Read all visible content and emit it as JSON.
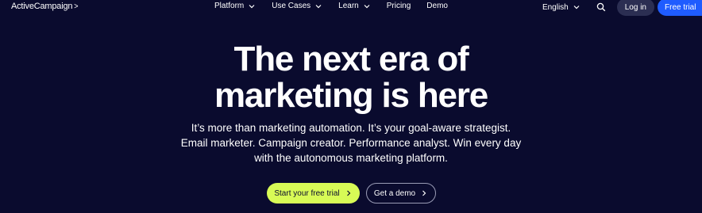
{
  "nav": {
    "logo": "ActiveCampaign",
    "logo_mark": ">",
    "links": [
      {
        "label": "Platform",
        "has_dropdown": true
      },
      {
        "label": "Use Cases",
        "has_dropdown": true
      },
      {
        "label": "Learn",
        "has_dropdown": true
      },
      {
        "label": "Pricing",
        "has_dropdown": false
      },
      {
        "label": "Demo",
        "has_dropdown": false
      }
    ],
    "language": "English",
    "login": "Log in",
    "free_trial": "Free trial"
  },
  "hero": {
    "headline_line1": "The next era of",
    "headline_line2": "marketing is here",
    "sub_line1": "It’s more than marketing automation. It’s your goal-aware strategist.",
    "sub_line2": "Email marketer. Campaign creator. Performance analyst. Win every day",
    "sub_line3": "with the autonomous marketing platform.",
    "cta_primary": "Start your free trial",
    "cta_secondary": "Get a demo"
  },
  "colors": {
    "background": "#0a0b2e",
    "primary_cta": "#d8fb56",
    "nav_trial": "#1f5cff"
  },
  "icons": [
    "chevron-down-icon",
    "search-icon",
    "chevron-right-icon"
  ]
}
